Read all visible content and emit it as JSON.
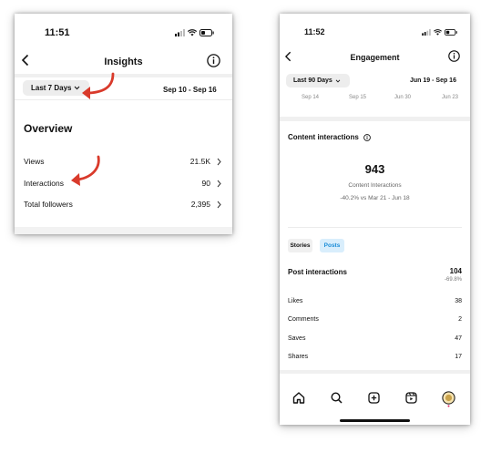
{
  "left": {
    "status_time": "11:51",
    "title": "Insights",
    "range_label": "Last 7 Days",
    "date_range": "Sep 10 - Sep 16",
    "section_title": "Overview",
    "rows": [
      {
        "label": "Views",
        "value": "21.5K"
      },
      {
        "label": "Interactions",
        "value": "90"
      },
      {
        "label": "Total followers",
        "value": "2,395"
      }
    ]
  },
  "right": {
    "status_time": "11:52",
    "title": "Engagement",
    "range_label": "Last 90 Days",
    "date_range": "Jun 19 - Sep 16",
    "axis_ticks": [
      "Sep 14",
      "Sep 15",
      "Jun 30",
      "Jun 23"
    ],
    "content_title": "Content interactions",
    "big_number": "943",
    "big_label": "Content Interactions",
    "comparison": "-40.2% vs Mar 21 - Jun 18",
    "tabs": [
      {
        "label": "Stories",
        "active": false
      },
      {
        "label": "Posts",
        "active": true
      }
    ],
    "post_title": "Post interactions",
    "post_value": "104",
    "post_change": "-69.8%",
    "rows": [
      {
        "label": "Likes",
        "value": "38"
      },
      {
        "label": "Comments",
        "value": "2"
      },
      {
        "label": "Saves",
        "value": "47"
      },
      {
        "label": "Shares",
        "value": "17"
      }
    ],
    "nav": [
      "home-icon",
      "search-icon",
      "create-icon",
      "reels-icon",
      "profile-avatar"
    ]
  },
  "colors": {
    "arrow": "#d93a2b",
    "active_tab_bg": "#d9eefc",
    "active_tab_text": "#1a8cd8"
  }
}
